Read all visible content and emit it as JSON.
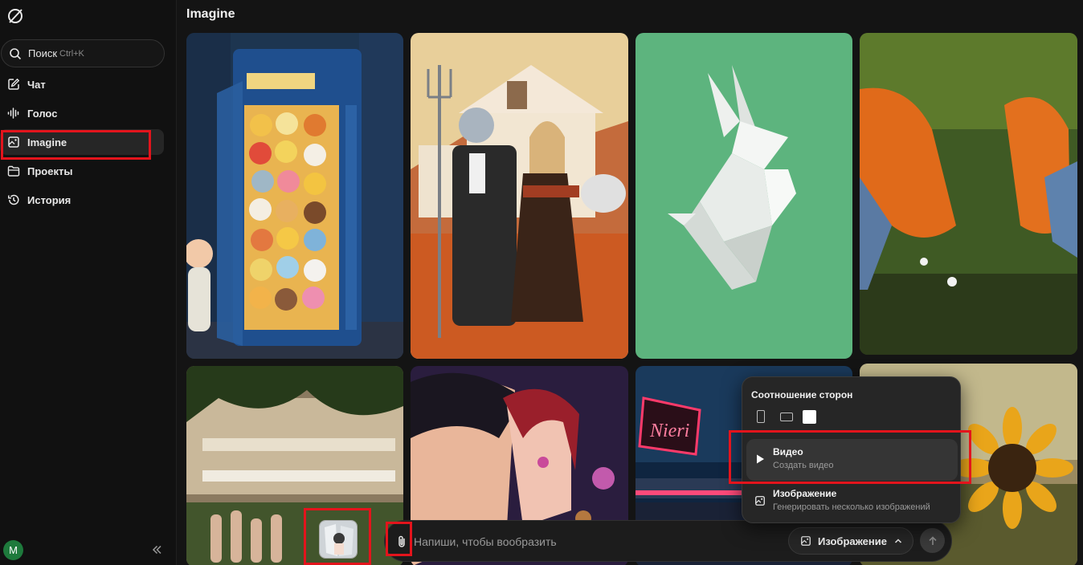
{
  "sidebar": {
    "search": {
      "label": "Поиск",
      "shortcut": "Ctrl+K"
    },
    "items": [
      {
        "id": "chat",
        "label": "Чат",
        "icon": "edit-icon"
      },
      {
        "id": "voice",
        "label": "Голос",
        "icon": "waveform-icon"
      },
      {
        "id": "imagine",
        "label": "Imagine",
        "icon": "image-icon",
        "active": true
      },
      {
        "id": "projects",
        "label": "Проекты",
        "icon": "folder-icon"
      },
      {
        "id": "history",
        "label": "История",
        "icon": "history-icon"
      }
    ],
    "avatar_initial": "M"
  },
  "page": {
    "title": "Imagine"
  },
  "gallery": [
    {
      "name": "phone-booth-teddy-bears"
    },
    {
      "name": "robot-american-gothic"
    },
    {
      "name": "origami-rabbit"
    },
    {
      "name": "orange-sneakers-grass"
    },
    {
      "name": "dancers-in-garden"
    },
    {
      "name": "anime-couple-neon"
    },
    {
      "name": "neon-diner-sign",
      "sign_text": "Nieri"
    },
    {
      "name": "sunflower"
    }
  ],
  "composer": {
    "placeholder": "Напиши, чтобы вообразить",
    "mode_label": "Изображение"
  },
  "popup": {
    "aspect_ratio_title": "Соотношение сторон",
    "options": [
      {
        "title": "Видео",
        "subtitle": "Создать видео",
        "icon": "play-icon",
        "selected": true
      },
      {
        "title": "Изображение",
        "subtitle": "Генерировать несколько изображений",
        "icon": "image-icon",
        "selected": false
      }
    ]
  },
  "colors": {
    "background": "#141414",
    "sidebar": "#111111",
    "highlight": "#e3141c",
    "avatar": "#1e7a3c"
  }
}
